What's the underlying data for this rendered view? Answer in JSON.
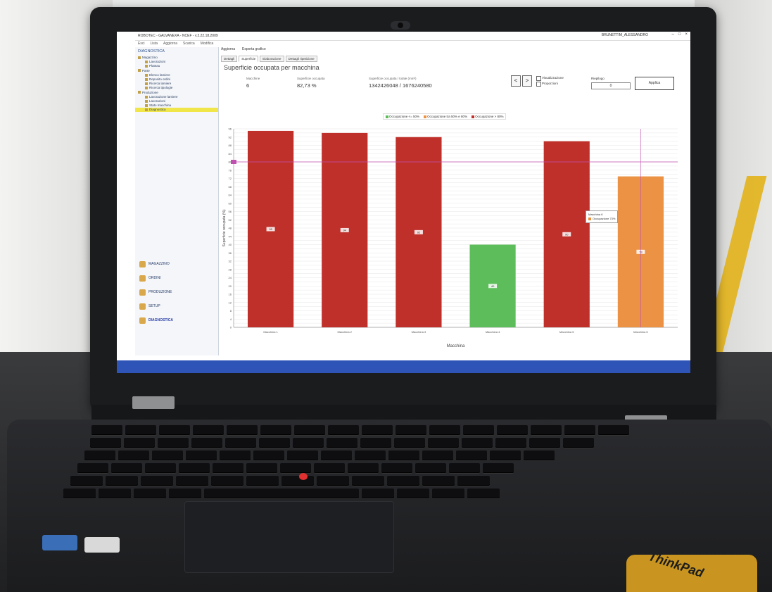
{
  "window": {
    "app_title": "ROBOTEC - GALVANEXA - NCEF - v.2.22.18.2009",
    "user": "BRUNETTIM_ALESSANDRO"
  },
  "toolbar": {
    "items": [
      "Esci",
      "Lista",
      "Aggiorna",
      "Scarica",
      "Modifica"
    ]
  },
  "left_panel": {
    "title": "DIAGNOSTICA",
    "tree": [
      {
        "label": "Magazzino"
      },
      {
        "label": "Lavorazioni"
      },
      {
        "label": "Plateau"
      },
      {
        "label": "Parte"
      },
      {
        "label": "Elenco lamiere"
      },
      {
        "label": "Deposito ordini"
      },
      {
        "label": "Ricerca lamiere"
      },
      {
        "label": "Ricerca tipologie"
      },
      {
        "label": "Produzione"
      },
      {
        "label": "Lavorazione lamiere"
      },
      {
        "label": "Lavorazioni"
      },
      {
        "label": "Stato macchina"
      },
      {
        "label": "Diagnostica",
        "selected": true
      }
    ],
    "nav": [
      {
        "label": "MAGAZZINO"
      },
      {
        "label": "ORDINI"
      },
      {
        "label": "PRODUZIONE"
      },
      {
        "label": "SETUP"
      },
      {
        "label": "DIAGNOSTICA",
        "active": true
      }
    ]
  },
  "main": {
    "actions": [
      "Aggiorna",
      "Esporta grafico"
    ],
    "tabs": [
      {
        "label": "Dettagli"
      },
      {
        "label": "Superficie",
        "active": true
      },
      {
        "label": "Elaborazione"
      },
      {
        "label": "Dettagli ripetizione"
      }
    ],
    "title": "Superficie occupata per macchina",
    "stats": {
      "machines_label": "Macchine",
      "machines_value": "6",
      "occupancy_label": "Superficie occupata",
      "occupancy_value": "82,73 %",
      "area_label": "Superficie occupata / totale (mm²)",
      "area_value": "1342426048 / 1676240580"
    },
    "controls": {
      "prev": "<",
      "next": ">",
      "check_1": "Visualizzazione",
      "check_2": "Proporzioni",
      "input_label": "Riepilogo",
      "input_value": "0",
      "apply_label": "Applica"
    }
  },
  "colors": {
    "bar_red": "#c0302a",
    "bar_green": "#5cbd5a",
    "bar_orange": "#eb9245",
    "threshold": "#c050b0",
    "accent_blue": "#2e54b8"
  },
  "chart_data": {
    "type": "bar",
    "ylabel": "Superficie occupata (%)",
    "xlabel": "Macchina",
    "ylim": [
      0,
      96
    ],
    "threshold": 80,
    "categories": [
      "Macchina 1",
      "Macchina 2",
      "Macchina 3",
      "Macchina 4",
      "Macchina 5",
      "Macchina 6"
    ],
    "values": [
      95,
      94,
      92,
      40,
      90,
      73
    ],
    "value_labels": [
      "95",
      "94",
      "92",
      "40",
      "90",
      "73"
    ],
    "bar_colors": [
      "red",
      "red",
      "red",
      "green",
      "red",
      "orange"
    ],
    "legend": [
      "Occupazione <= 50%",
      "Occupazione tra 50% e 80%",
      "Occupazione > 80%"
    ],
    "tooltip": [
      "Macchina 6",
      "Occupazione 73%"
    ]
  },
  "brand": "ThinkPad"
}
